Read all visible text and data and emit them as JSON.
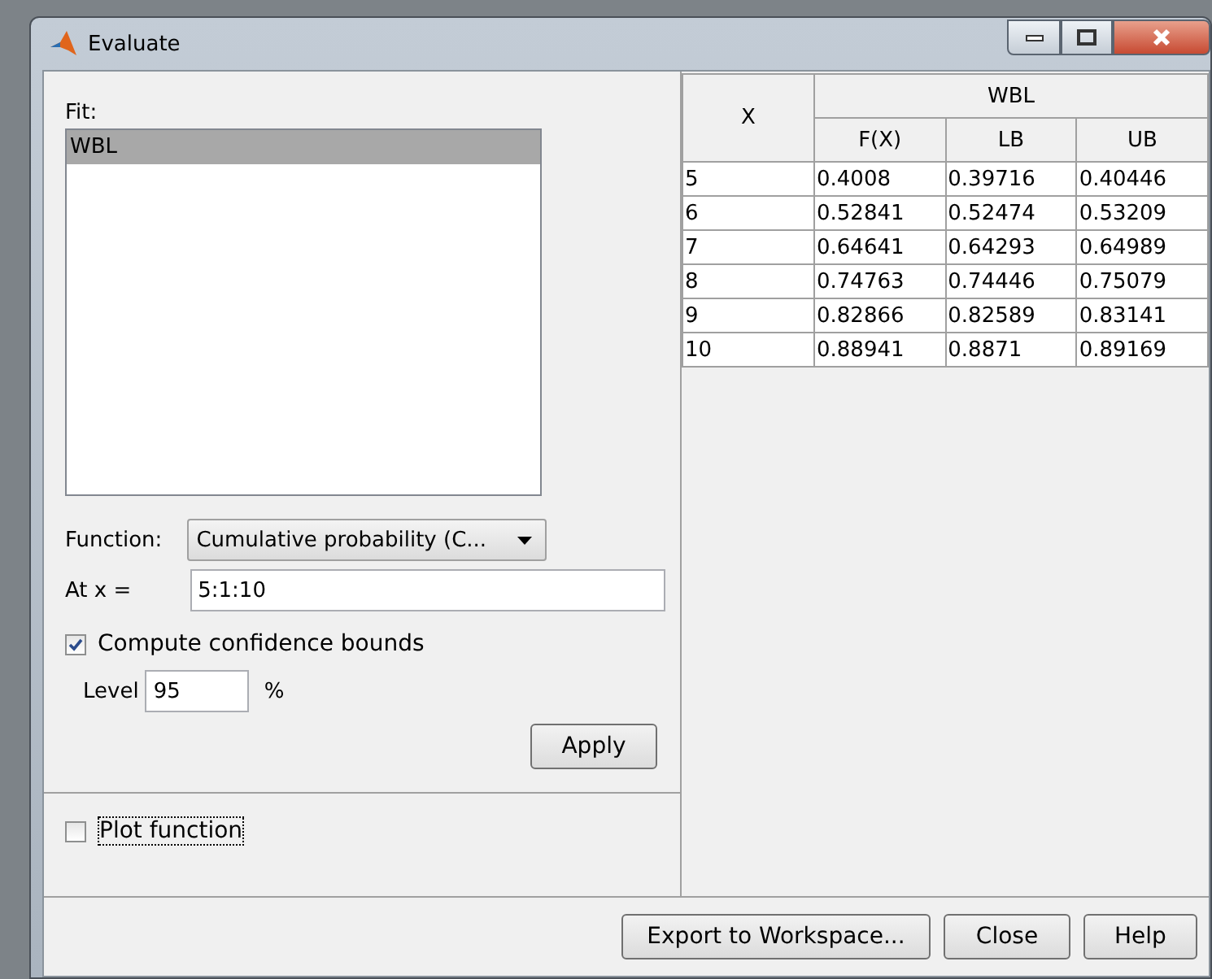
{
  "window": {
    "title": "Evaluate"
  },
  "fit": {
    "label": "Fit:",
    "items": [
      {
        "label": "WBL",
        "selected": true
      }
    ]
  },
  "function": {
    "label": "Function:",
    "value": "Cumulative probability (C..."
  },
  "at_x": {
    "label": "At x =",
    "value": "5:1:10"
  },
  "confidence": {
    "label": "Compute confidence bounds",
    "checked": true
  },
  "level": {
    "label": "Level",
    "value": "95",
    "unit": "%"
  },
  "apply_button": "Apply",
  "plot_function": {
    "label": "Plot function",
    "checked": false
  },
  "table": {
    "group": "WBL",
    "columns": [
      "X",
      "F(X)",
      "LB",
      "UB"
    ],
    "rows": [
      [
        "5",
        "0.4008",
        "0.39716",
        "0.40446"
      ],
      [
        "6",
        "0.52841",
        "0.52474",
        "0.53209"
      ],
      [
        "7",
        "0.64641",
        "0.64293",
        "0.64989"
      ],
      [
        "8",
        "0.74763",
        "0.74446",
        "0.75079"
      ],
      [
        "9",
        "0.82866",
        "0.82589",
        "0.83141"
      ],
      [
        "10",
        "0.88941",
        "0.8871",
        "0.89169"
      ]
    ]
  },
  "buttons": [
    "Export to Workspace...",
    "Close",
    "Help"
  ]
}
